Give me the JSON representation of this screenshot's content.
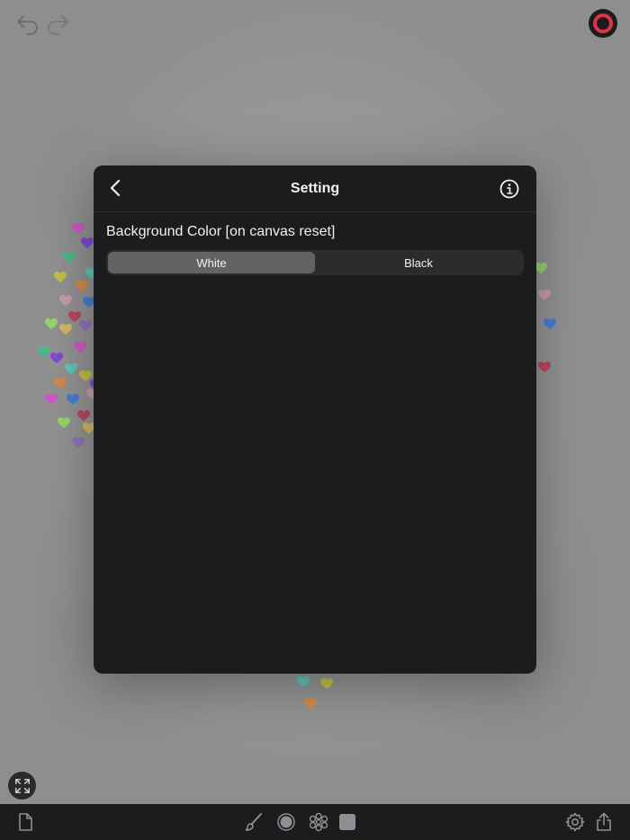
{
  "top_bar": {
    "undo_icon": "undo-arrow-icon",
    "redo_icon": "redo-arrow-icon",
    "current_color": "#e0304a"
  },
  "dialog": {
    "title": "Setting",
    "back_icon": "chevron-left-icon",
    "info_icon": "info-circle-icon",
    "section_label": "Background Color [on canvas reset]",
    "segments": [
      "White",
      "Black"
    ],
    "selected_segment": "White"
  },
  "bottom_toolbar": {
    "icons": [
      "document-icon",
      "brush-icon",
      "circle-brush-icon",
      "flower-pattern-icon",
      "square-shape-icon",
      "gear-icon",
      "share-icon"
    ]
  },
  "colors": {
    "dialog_bg": "#1c1c1e",
    "segment_active": "#636366",
    "accent_red": "#e0304a"
  }
}
